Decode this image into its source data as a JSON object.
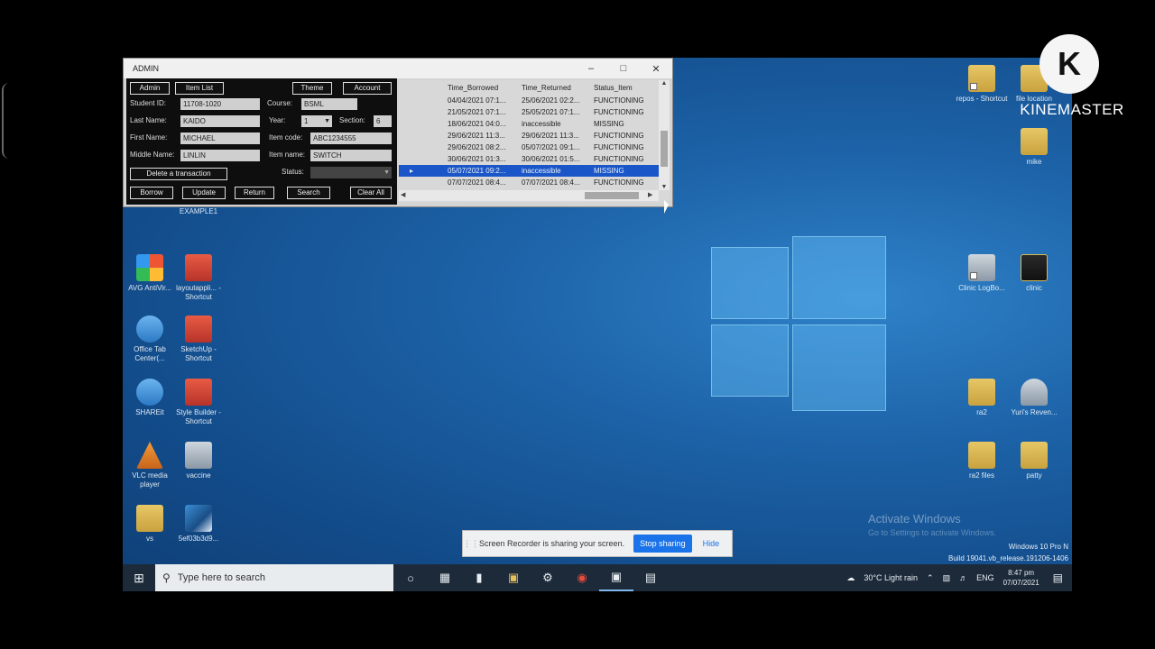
{
  "watermark": {
    "line1": "K",
    "line2": "KINEMASTER"
  },
  "admin_window": {
    "title": "ADMIN",
    "buttons": {
      "admin": "Admin",
      "item_list": "Item List",
      "theme": "Theme",
      "account": "Account",
      "delete": "Delete a transaction",
      "borrow": "Borrow",
      "update": "Update",
      "return": "Return",
      "search": "Search",
      "clear_all": "Clear All"
    },
    "labels": {
      "student_id": "Student ID:",
      "course": "Course:",
      "last_name": "Last Name:",
      "year": "Year:",
      "section": "Section:",
      "first_name": "First Name:",
      "item_code": "Item code:",
      "middle_name": "Middle Name:",
      "item_name": "Item name:",
      "status": "Status:"
    },
    "values": {
      "student_id": "11708-1020",
      "course": "BSML",
      "last_name": "KAIDO",
      "year": "1",
      "section": "6",
      "first_name": "MICHAEL",
      "item_code": "ABC1234555",
      "middle_name": "LINLIN",
      "item_name": "SWITCH",
      "status": ""
    },
    "grid": {
      "headers": [
        "Time_Borrowed",
        "Time_Returned",
        "Status_Item"
      ],
      "rows": [
        [
          "04/04/2021 07:1...",
          "25/06/2021 02:2...",
          "FUNCTIONING"
        ],
        [
          "21/05/2021 07:1...",
          "25/05/2021 07:1...",
          "FUNCTIONING"
        ],
        [
          "18/06/2021 04:0...",
          "inaccessible",
          "MISSING"
        ],
        [
          "29/06/2021 11:3...",
          "29/06/2021 11:3...",
          "FUNCTIONING"
        ],
        [
          "29/06/2021 08:2...",
          "05/07/2021 09:1...",
          "FUNCTIONING"
        ],
        [
          "30/06/2021 01:3...",
          "30/06/2021 01:5...",
          "FUNCTIONING"
        ],
        [
          "05/07/2021 09:2...",
          "inaccessible",
          "MISSING"
        ],
        [
          "07/07/2021 08:4...",
          "07/07/2021 08:4...",
          "FUNCTIONING"
        ]
      ],
      "selected_row": 6
    }
  },
  "desktop_icons": {
    "example": "EXAMPLE1",
    "avg": "AVG AntiVir...",
    "layout": "layoutappli... - Shortcut",
    "office": "Office Tab Center(...",
    "sketchup": "SketchUp - Shortcut",
    "shareit": "SHAREit",
    "style": "Style Builder - Shortcut",
    "vlc": "VLC media player",
    "vaccine": "vaccine",
    "vs": "vs",
    "img": "5ef03b3d9...",
    "repos": "repos - Shortcut",
    "fileloc": "file location",
    "mike": "mike",
    "cliniclog": "Clinic LogBo...",
    "clinic": "clinic",
    "ra2": "ra2",
    "yuri": "Yuri's Reven...",
    "ra2files": "ra2 files",
    "patty": "patty"
  },
  "share_bar": {
    "message": "Screen Recorder is sharing your screen.",
    "stop": "Stop sharing",
    "hide": "Hide"
  },
  "activation": {
    "title": "Activate Windows",
    "subtitle": "Go to Settings to activate Windows.",
    "edition": "Windows 10 Pro N",
    "build": "Build 19041.vb_release.191206-1406"
  },
  "taskbar": {
    "search_placeholder": "Type here to search",
    "weather": "30°C  Light rain",
    "lang": "ENG",
    "time": "8:47 pm",
    "date": "07/07/2021"
  }
}
